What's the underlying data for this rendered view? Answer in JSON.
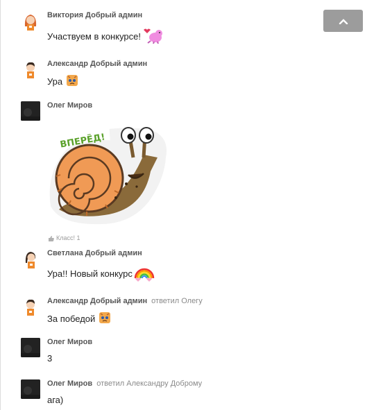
{
  "comments": [
    {
      "author": "Виктория Добрый админ",
      "reply_to": "",
      "text": "Участвуем в конкурсе!"
    },
    {
      "author": "Александр Добрый админ",
      "reply_to": "",
      "text": "Ура"
    },
    {
      "author": "Олег Миров",
      "reply_to": "",
      "text": ""
    },
    {
      "author": "Светлана Добрый админ",
      "reply_to": "",
      "text": "Ура!! Новый конкурс"
    },
    {
      "author": "Александр Добрый админ",
      "reply_to": "ответил Олегу",
      "text": "За победой"
    },
    {
      "author": "Олег Миров",
      "reply_to": "",
      "text": "3"
    },
    {
      "author": "Олег Миров",
      "reply_to": "ответил Александру Доброму",
      "text": "ага)"
    }
  ],
  "sticker": {
    "caption": "ВПЕРЁД!",
    "icon": "snail-sticker"
  },
  "likes": {
    "label": "Класс! 1",
    "icon": "thumbs-up-icon"
  },
  "scroll_up": {
    "icon": "chevron-up-icon"
  },
  "colors": {
    "author": "#555555",
    "reply": "#8a8a8a",
    "scroll_button": "#9c9c9c",
    "sticker_green": "#5aa12a",
    "snail_shell": "#f09a55"
  }
}
